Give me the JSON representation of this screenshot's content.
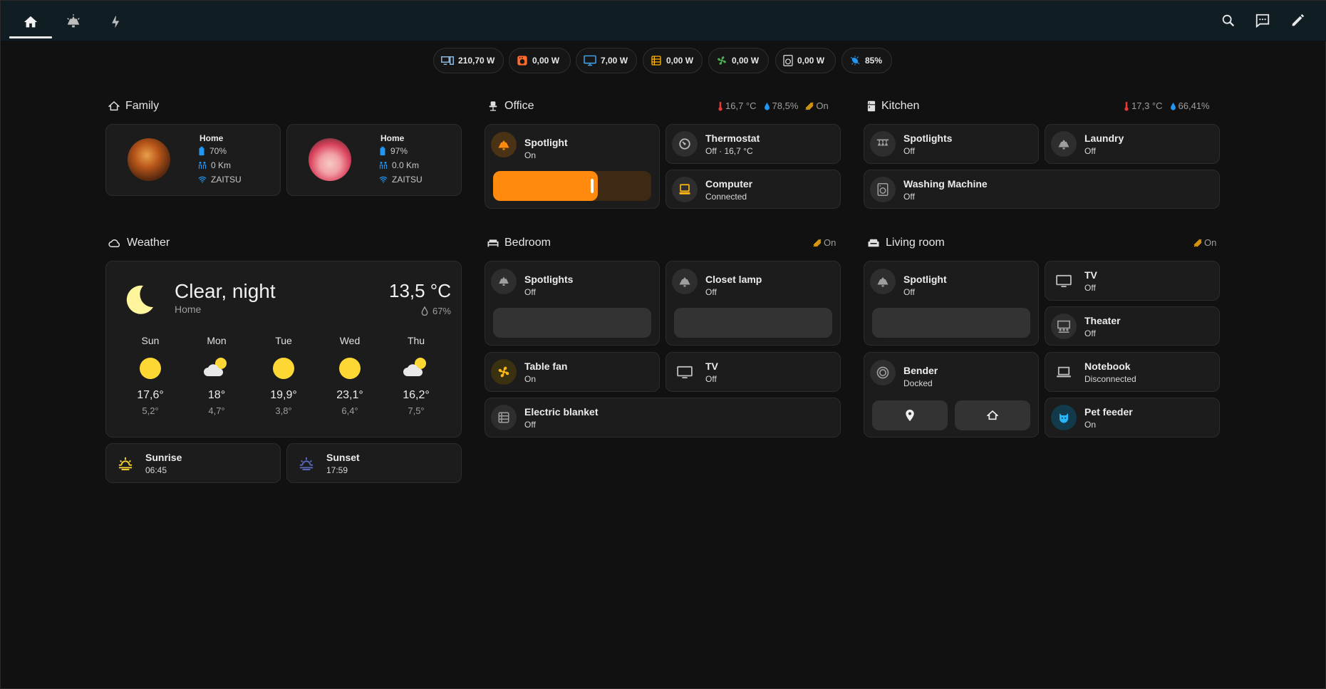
{
  "nav": {
    "tabs": [
      "home-icon",
      "light-icon",
      "energy-icon"
    ],
    "actions": [
      "search-icon",
      "assist-icon",
      "edit-icon"
    ]
  },
  "power_chips": [
    {
      "icon": "pc-icon",
      "value": "210,70 W",
      "color": "#8ab4d8"
    },
    {
      "icon": "oven-icon",
      "value": "0,00 W",
      "color": "#ff6d2e"
    },
    {
      "icon": "monitor-icon",
      "value": "7,00 W",
      "color": "#3fa9f5"
    },
    {
      "icon": "blanket-icon",
      "value": "0,00 W",
      "color": "#ffb300"
    },
    {
      "icon": "fan-icon",
      "value": "0,00 W",
      "color": "#4caf50"
    },
    {
      "icon": "washer-icon",
      "value": "0,00 W",
      "color": "#d0d0d0"
    },
    {
      "icon": "bacteria-icon",
      "value": "85%",
      "color": "#2196f3"
    }
  ],
  "family": {
    "title": "Family",
    "persons": [
      {
        "state": "Home",
        "battery": "70%",
        "distance": "0 Km",
        "wifi": "ZAITSU"
      },
      {
        "state": "Home",
        "battery": "97%",
        "distance": "0.0 Km",
        "wifi": "ZAITSU"
      }
    ]
  },
  "office": {
    "title": "Office",
    "temperature": "16,7 °C",
    "humidity": "78,5%",
    "lights": "On",
    "spotlight": {
      "name": "Spotlight",
      "state": "On",
      "brightness": 0.66
    },
    "thermostat": {
      "name": "Thermostat",
      "state": "Off · 16,7 °C"
    },
    "computer": {
      "name": "Computer",
      "state": "Connected"
    }
  },
  "kitchen": {
    "title": "Kitchen",
    "temperature": "17,3 °C",
    "humidity": "66,41%",
    "spotlights": {
      "name": "Spotlights",
      "state": "Off"
    },
    "laundry": {
      "name": "Laundry",
      "state": "Off"
    },
    "washing": {
      "name": "Washing Machine",
      "state": "Off"
    }
  },
  "weather": {
    "title": "Weather",
    "condition": "Clear, night",
    "location": "Home",
    "temperature": "13,5 °C",
    "humidity": "67%",
    "forecast": [
      {
        "day": "Sun",
        "icon": "sunny-icon",
        "high": "17,6°",
        "low": "5,2°"
      },
      {
        "day": "Mon",
        "icon": "partly-cloudy-icon",
        "high": "18°",
        "low": "4,7°"
      },
      {
        "day": "Tue",
        "icon": "sunny-icon",
        "high": "19,9°",
        "low": "3,8°"
      },
      {
        "day": "Wed",
        "icon": "sunny-icon",
        "high": "23,1°",
        "low": "6,4°"
      },
      {
        "day": "Thu",
        "icon": "partly-cloudy-icon",
        "high": "16,2°",
        "low": "7,5°"
      }
    ],
    "sunrise": {
      "name": "Sunrise",
      "time": "06:45"
    },
    "sunset": {
      "name": "Sunset",
      "time": "17:59"
    }
  },
  "bedroom": {
    "title": "Bedroom",
    "lights": "On",
    "spotlights": {
      "name": "Spotlights",
      "state": "Off"
    },
    "closet": {
      "name": "Closet lamp",
      "state": "Off"
    },
    "fan": {
      "name": "Table fan",
      "state": "On"
    },
    "tv": {
      "name": "TV",
      "state": "Off"
    },
    "blanket": {
      "name": "Electric blanket",
      "state": "Off"
    }
  },
  "living": {
    "title": "Living room",
    "lights": "On",
    "spotlight": {
      "name": "Spotlight",
      "state": "Off"
    },
    "tv": {
      "name": "TV",
      "state": "Off"
    },
    "theater": {
      "name": "Theater",
      "state": "Off"
    },
    "bender": {
      "name": "Bender",
      "state": "Docked"
    },
    "notebook": {
      "name": "Notebook",
      "state": "Disconnected"
    },
    "feeder": {
      "name": "Pet feeder",
      "state": "On"
    }
  },
  "colors": {
    "accent_orange": "#ff8a0d",
    "temp_red": "#e53935",
    "humidity_blue": "#2196f3",
    "sun_yellow": "#fdd835"
  }
}
